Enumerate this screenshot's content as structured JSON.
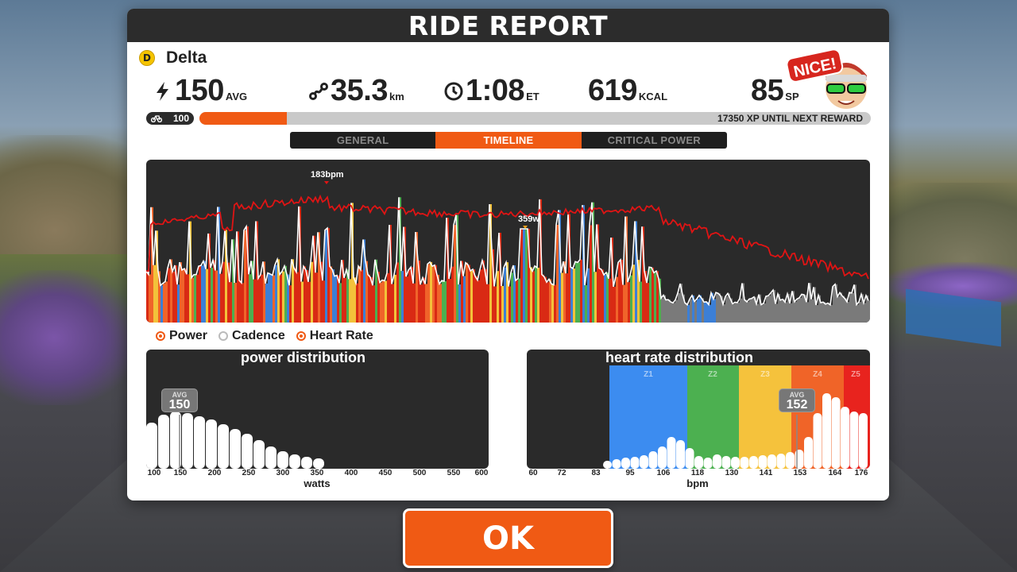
{
  "header": {
    "title": "RIDE REPORT"
  },
  "rider": {
    "category": "D",
    "name": "Delta"
  },
  "stats": {
    "power": {
      "value": "150",
      "unit": "AVG",
      "icon": "lightning-icon"
    },
    "distance": {
      "value": "35.3",
      "unit": "km",
      "icon": "route-icon"
    },
    "time": {
      "value": "1:08",
      "unit": "ET",
      "icon": "clock-icon"
    },
    "calories": {
      "value": "619",
      "unit": "KCAL"
    },
    "sport_points": {
      "value": "85",
      "unit": "SP"
    }
  },
  "avatar": {
    "badge_text": "NICE!"
  },
  "progress": {
    "level": "100",
    "xp_fraction": 0.13,
    "xp_text": "17350 XP UNTIL NEXT REWARD"
  },
  "tabs": [
    {
      "label": "GENERAL",
      "active": false
    },
    {
      "label": "TIMELINE",
      "active": true
    },
    {
      "label": "CRITICAL POWER",
      "active": false
    }
  ],
  "timeline": {
    "hr_peak_label": "183bpm",
    "power_peak_label": "359w",
    "colors": {
      "heart_rate": "#e01414",
      "power": "#ffffff",
      "z_blue": "#3c7fd6",
      "z_green": "#4caf50",
      "z_yellow": "#f3c23a",
      "z_orange": "#f0642a",
      "z_red": "#d92a14",
      "z_grey": "#7a7a7a"
    }
  },
  "legend": [
    {
      "label": "Power",
      "on": true
    },
    {
      "label": "Cadence",
      "on": false
    },
    {
      "label": "Heart Rate",
      "on": true
    }
  ],
  "power_distribution": {
    "title": "power distribution",
    "avg_label": "AVG",
    "avg_value": "150",
    "ticks": [
      "100",
      "150",
      "200",
      "250",
      "300",
      "350",
      "400",
      "450",
      "500",
      "550",
      "600"
    ],
    "axis_label": "watts"
  },
  "hr_distribution": {
    "title": "heart rate distribution",
    "zones": [
      "Z1",
      "Z2",
      "Z3",
      "Z4",
      "Z5"
    ],
    "zone_colors": [
      "#3c8cf0",
      "#4cb050",
      "#f5c23c",
      "#f06428",
      "#e8231e"
    ],
    "avg_label": "AVG",
    "avg_value": "152",
    "ticks": [
      "60",
      "72",
      "83",
      "95",
      "106",
      "118",
      "130",
      "141",
      "153",
      "164",
      "176"
    ],
    "axis_label": "bpm"
  },
  "ok_button": {
    "label": "OK"
  }
}
